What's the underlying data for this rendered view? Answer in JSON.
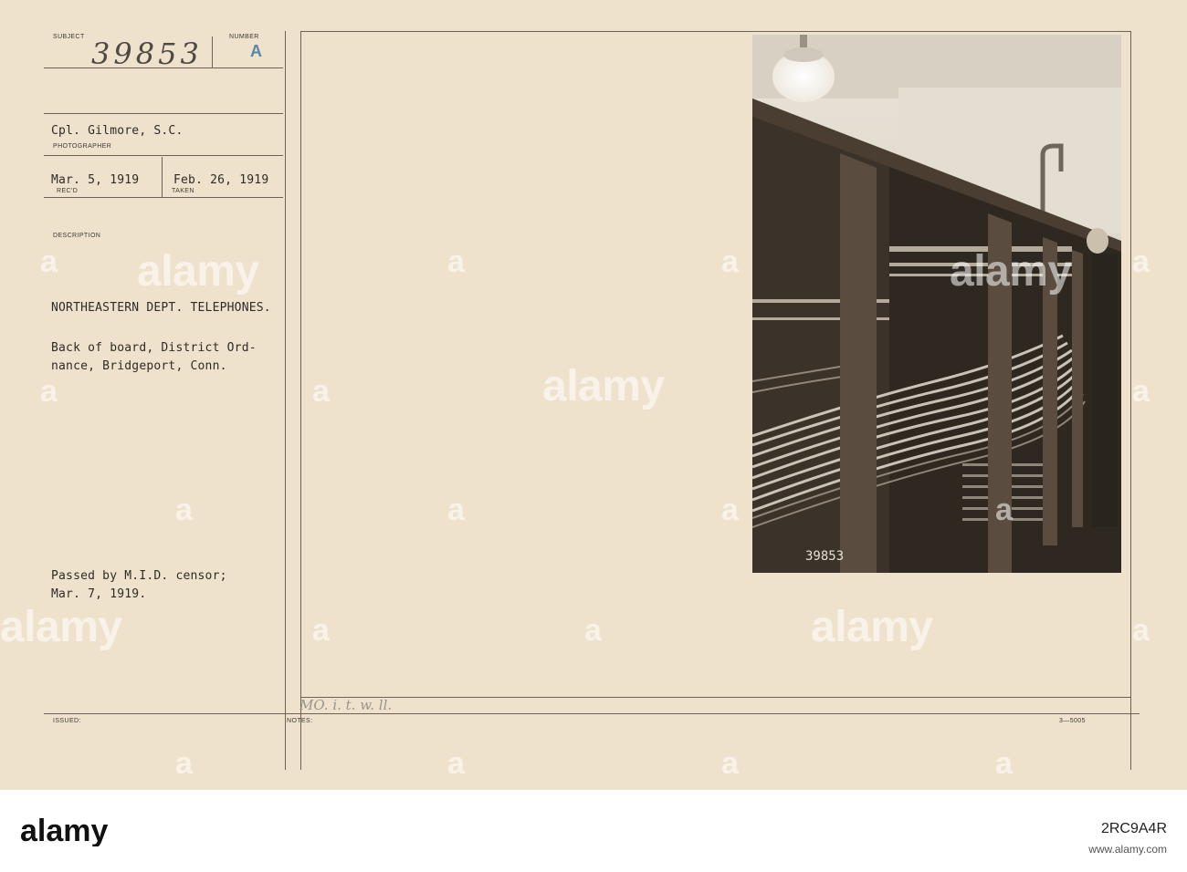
{
  "card": {
    "labels": {
      "subject": "SUBJECT",
      "number": "NUMBER",
      "photographer": "PHOTOGRAPHER",
      "recd": "REC'D",
      "taken": "TAKEN",
      "description": "DESCRIPTION",
      "issued": "ISSUED:",
      "notes": "NOTES:"
    },
    "subject_number": "39853",
    "number_value": "A",
    "photographer": "Cpl. Gilmore, S.C.",
    "date_received": "Mar. 5, 1919",
    "date_taken": "Feb. 26, 1919",
    "description_lines": [
      "NORTHEASTERN DEPT. TELEPHONES.",
      "Back of board, District Ord-",
      "nance, Bridgeport, Conn."
    ],
    "censor_lines": [
      "Passed by M.I.D. censor;",
      "Mar. 7, 1919."
    ],
    "notes_handwritten": "MO. i. t. w. ll.",
    "form_code": "3—5005"
  },
  "photo": {
    "negative_number": "39853"
  },
  "watermark": {
    "brand": "alamy"
  },
  "footer": {
    "brand": "alamy",
    "image_id": "2RC9A4R",
    "url": "www.alamy.com"
  }
}
